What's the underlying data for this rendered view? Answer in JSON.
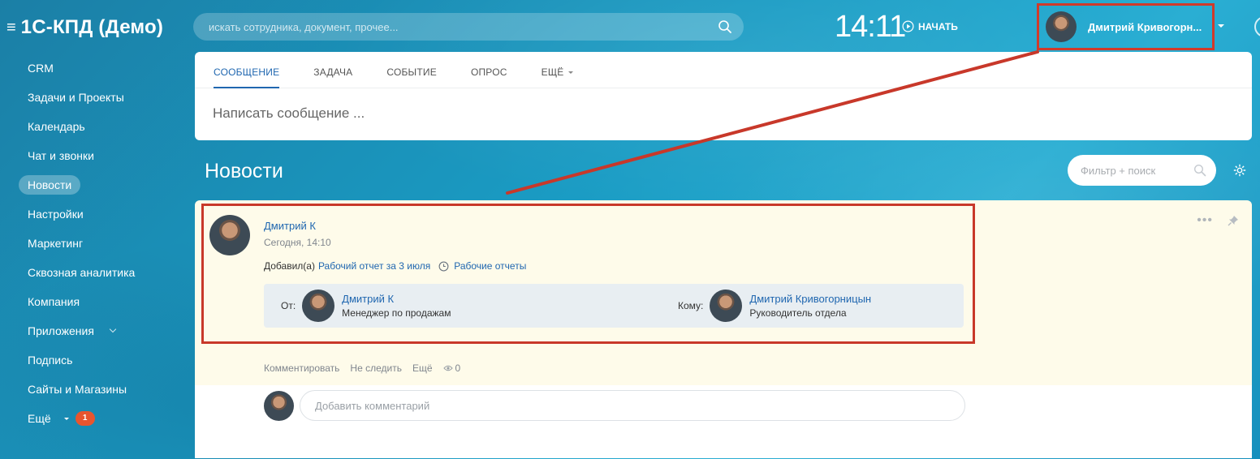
{
  "app": {
    "title": "1С-КПД (Демо)"
  },
  "search": {
    "placeholder": "искать сотрудника, документ, прочее..."
  },
  "header": {
    "time": "14:11",
    "start_label": "НАЧАТЬ",
    "user_name": "Дмитрий Кривогорн..."
  },
  "sidebar": {
    "items": [
      {
        "label": "CRM"
      },
      {
        "label": "Задачи и Проекты"
      },
      {
        "label": "Календарь"
      },
      {
        "label": "Чат и звонки"
      },
      {
        "label": "Новости",
        "active": true
      },
      {
        "label": "Настройки"
      },
      {
        "label": "Маркетинг"
      },
      {
        "label": "Сквозная аналитика"
      },
      {
        "label": "Компания"
      },
      {
        "label": "Приложения"
      },
      {
        "label": "Подпись"
      },
      {
        "label": "Сайты и Магазины"
      },
      {
        "label": "Ещё",
        "badge": "1"
      }
    ]
  },
  "composer": {
    "tabs": [
      "СООБЩЕНИЕ",
      "ЗАДАЧА",
      "СОБЫТИЕ",
      "ОПРОС",
      "ЕЩЁ"
    ],
    "placeholder": "Написать сообщение ..."
  },
  "news": {
    "title": "Новости",
    "filter_placeholder": "Фильтр + поиск"
  },
  "post": {
    "author": "Дмитрий К",
    "date": "Сегодня, 14:10",
    "action_prefix": "Добавил(а)",
    "report_link": "Рабочий отчет за 3 июля",
    "reports_link": "Рабочие отчеты",
    "from": {
      "label": "От:",
      "name": "Дмитрий К",
      "role": "Менеджер по продажам"
    },
    "to": {
      "label": "Кому:",
      "name": "Дмитрий Кривогорницын",
      "role": "Руководитель отдела"
    },
    "footer": {
      "comment": "Комментировать",
      "unfollow": "Не следить",
      "more": "Ещё",
      "views": "0"
    },
    "comment_placeholder": "Добавить комментарий"
  },
  "colors": {
    "highlight": "#c8382a",
    "link": "#2067b0",
    "accent_badge": "#e8552e"
  }
}
